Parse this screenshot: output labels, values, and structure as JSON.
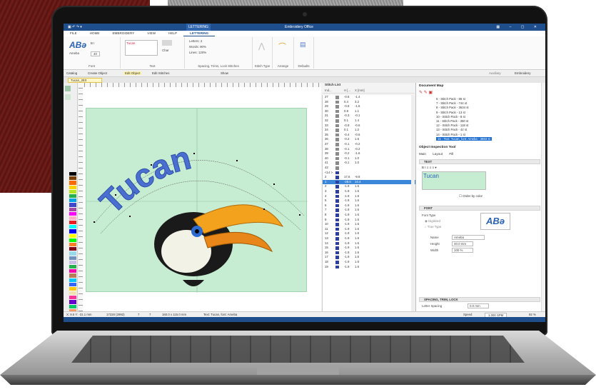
{
  "app": {
    "title": "Embroidery Office",
    "context_tab": "LETTERING"
  },
  "menu": [
    "FILE",
    "HOME",
    "EMBROIDERY",
    "VIEW",
    "HELP",
    "LETTERING"
  ],
  "ribbon": {
    "font_group_label": "Font",
    "font_name": "Ameba",
    "font_sample": "ABə",
    "font_size": "40",
    "text_group_label": "Text",
    "text_value": "Tucan",
    "char_label": "Char",
    "letters_label": "Letters",
    "letters_value": "2",
    "words_label": "Words",
    "words_value": "90%",
    "lines_label": "Lines",
    "lines_value": "120%",
    "spacing_group_label": "Spacing, Trims, Lock Stitches",
    "stitch_type_label": "Stitch Type",
    "arrange_label": "Arrange",
    "defaults_label": "Defaults"
  },
  "toolbar": {
    "catalog": "Catalog",
    "create_object": "Create Object",
    "edit_object": "Edit Object",
    "edit_stitches": "Edit Stitches",
    "show": "Show",
    "auxiliary": "Auxiliary",
    "embroidery": "Embroidery"
  },
  "document_tab": "Tucan_2E0",
  "design_text": "Tucan",
  "stitch_list": {
    "title": "Stitch List",
    "headers": [
      "Ind...",
      "H [...",
      "X [mm]"
    ],
    "rows": [
      [
        "27",
        "-0.6",
        "-1.4"
      ],
      [
        "28",
        "0.4",
        "3.2"
      ],
      [
        "29",
        "-0.6",
        "-1.6"
      ],
      [
        "30",
        "0.8",
        "1.1"
      ],
      [
        "31",
        "-0.3",
        "-0.1"
      ],
      [
        "32",
        "0.1",
        "1.4"
      ],
      [
        "33",
        "-0.9",
        "-0.6"
      ],
      [
        "34",
        "0.1",
        "1.2"
      ],
      [
        "35",
        "-0.4",
        "-0.6"
      ],
      [
        "36",
        "-0.2",
        "1.6"
      ],
      [
        "37",
        "-0.1",
        "-0.2"
      ],
      [
        "38",
        "-0.1",
        "-0.2"
      ],
      [
        "39",
        "-0.2",
        "-1.6"
      ],
      [
        "40",
        "-0.1",
        "1.0"
      ],
      [
        "41",
        "-0.1",
        "1.0"
      ],
      [
        "42",
        "",
        ""
      ],
      [
        "<14 >",
        "",
        ""
      ],
      [
        "2",
        "17.6",
        "-9.8"
      ],
      [
        "1",
        "-28.0",
        "14.4"
      ],
      [
        "2",
        "-1.9",
        "1.6"
      ],
      [
        "3",
        "-1.9",
        "1.6"
      ],
      [
        "4",
        "-1.9",
        "1.6"
      ],
      [
        "5",
        "-1.9",
        "1.6"
      ],
      [
        "6",
        "-1.9",
        "1.6"
      ],
      [
        "7",
        "-1.9",
        "1.6"
      ],
      [
        "8",
        "-1.9",
        "1.6"
      ],
      [
        "9",
        "-1.9",
        "1.6"
      ],
      [
        "10",
        "-1.9",
        "1.6"
      ],
      [
        "11",
        "-1.9",
        "1.6"
      ],
      [
        "12",
        "-1.9",
        "1.6"
      ],
      [
        "13",
        "-1.9",
        "1.6"
      ],
      [
        "14",
        "-1.9",
        "1.6"
      ],
      [
        "15",
        "-1.9",
        "1.6"
      ],
      [
        "16",
        "-1.9",
        "1.6"
      ],
      [
        "17",
        "-1.9",
        "1.6"
      ],
      [
        "18",
        "-1.9",
        "1.6"
      ],
      [
        "19",
        "-1.9",
        "1.6"
      ]
    ],
    "selected_row": 18
  },
  "document_map": {
    "title": "Document Map",
    "items": [
      "6 - Stitch Pack - 86 st",
      "7 - Stitch Pack - 744 st",
      "8 - Stitch Pack - 3634 st",
      "9 - Stitch Pack - 13 st",
      "10 - Stitch Pack - 8 st",
      "11 - Stitch Pack - 350 st",
      "12 - Stitch Pack - 118 st",
      "13 - Stitch Pack - 42 st",
      "14 - Stitch Pack - 1 st",
      "15 - Text: Tucan_font: Ameba - 3693 st"
    ]
  },
  "inspection": {
    "title": "Object Inspection Tool",
    "tabs": [
      "Main",
      "Layout",
      "Fill"
    ],
    "text_section": "TEXT",
    "text_value": "Tucan",
    "order_by_color": "Order by color",
    "font_section": "FONT",
    "font_type_label": "Font Type",
    "digitized_label": "Digitized",
    "true_type_label": "True Type",
    "name_label": "Name",
    "name_value": "Ameba",
    "height_label": "Height",
    "height_value": "40.0 mm",
    "width_label": "Width",
    "width_value": "100 %",
    "sample": "ABə",
    "spacing_section": "SPACING, TRIM, LOCK",
    "letter_spacing_label": "Letter Spacing",
    "letter_spacing_value": "0.0 mm"
  },
  "status": {
    "coord": "X: 9.5 Y: -31.1 mm",
    "stitches": "17228 (2992)",
    "colors": "7",
    "trims": "7",
    "size": "160.0 x 115.0 mm",
    "object": "Text: Tucan, font: Ameba",
    "speed_label": "Speed",
    "speed_value": "1,000 SPM",
    "zoom": "92 %"
  },
  "colors": {
    "accent": "#1f4e8c",
    "hoop": "#c6ecd2",
    "lettering": "#4b6fd1"
  }
}
